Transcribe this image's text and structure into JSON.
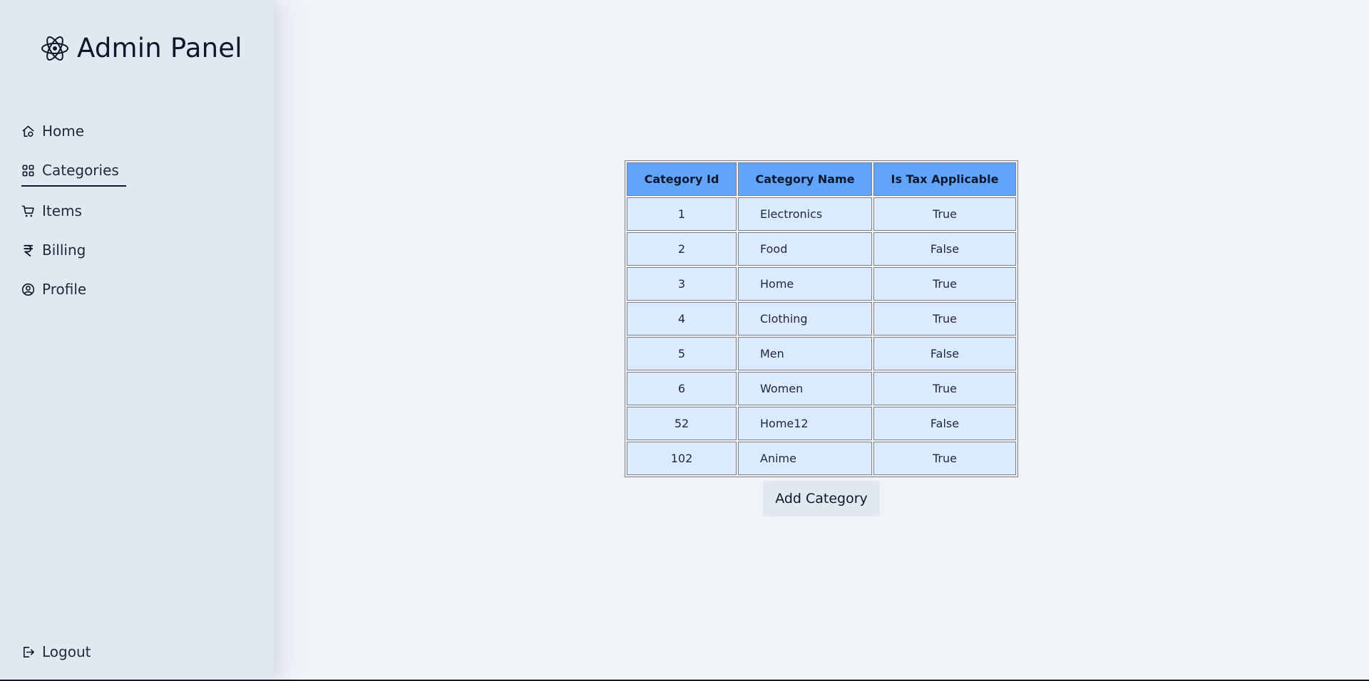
{
  "brand": {
    "title": "Admin Panel",
    "icon": "react-atom-icon"
  },
  "nav": {
    "home": {
      "label": "Home",
      "icon": "home-icon"
    },
    "categories": {
      "label": "Categories",
      "icon": "grid-icon",
      "active": true
    },
    "items": {
      "label": "Items",
      "icon": "cart-icon"
    },
    "billing": {
      "label": "Billing",
      "icon": "rupee-icon"
    },
    "profile": {
      "label": "Profile",
      "icon": "user-circle-icon"
    },
    "logout": {
      "label": "Logout",
      "icon": "logout-icon"
    }
  },
  "table": {
    "headers": [
      "Category Id",
      "Category Name",
      "Is Tax Applicable"
    ],
    "rows": [
      [
        "1",
        "Electronics",
        "True"
      ],
      [
        "2",
        "Food",
        "False"
      ],
      [
        "3",
        "Home",
        "True"
      ],
      [
        "4",
        "Clothing",
        "True"
      ],
      [
        "5",
        "Men",
        "False"
      ],
      [
        "6",
        "Women",
        "True"
      ],
      [
        "52",
        "Home12",
        "False"
      ],
      [
        "102",
        "Anime",
        "True"
      ]
    ]
  },
  "actions": {
    "add_category": "Add Category"
  },
  "colors": {
    "sidebar_bg": "#e2e8f0",
    "page_bg": "#f0f4f9",
    "header_bg": "#60a5fa",
    "cell_bg": "#dbeafe"
  }
}
